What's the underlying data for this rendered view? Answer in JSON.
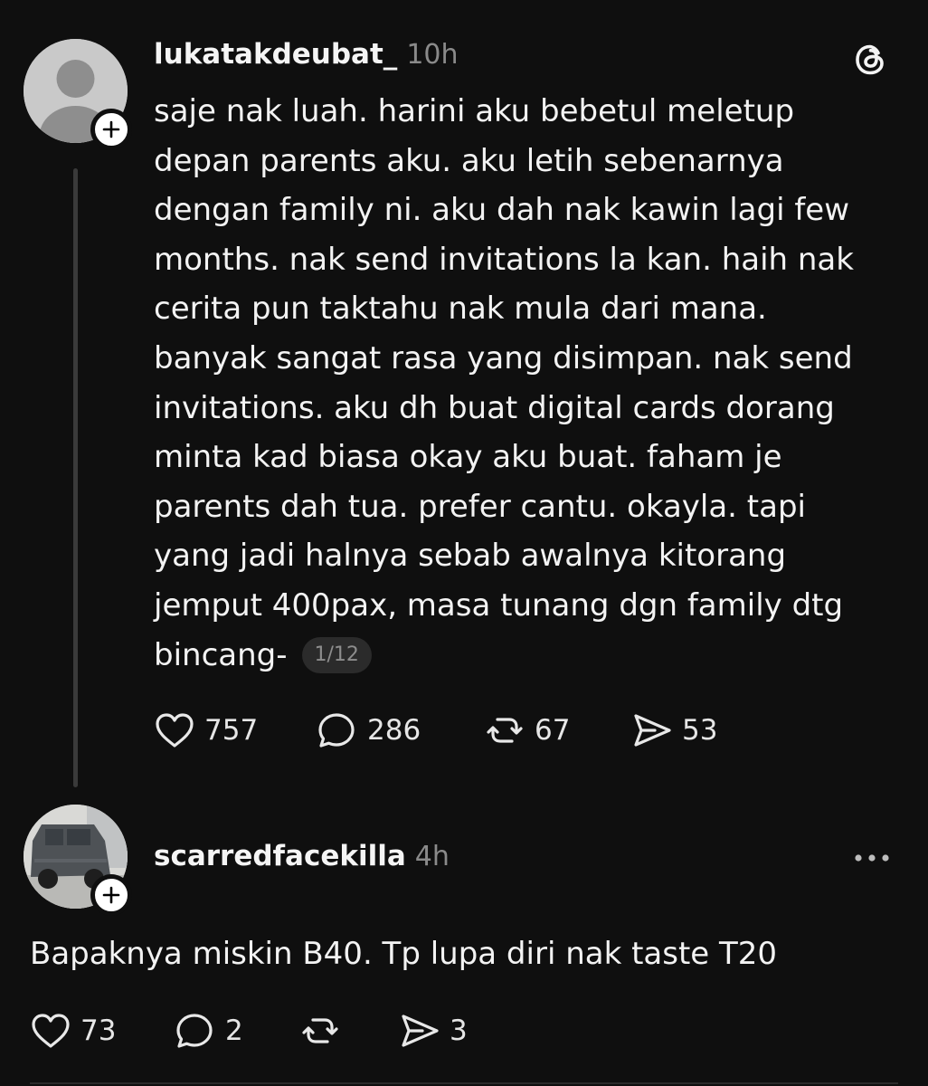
{
  "post": {
    "username": "lukatakdeubat_",
    "time": "10h",
    "lines": [
      "saje nak luah. harini aku bebetul meletup",
      "depan parents aku. aku letih sebenarnya",
      "dengan family ni. aku dah nak kawin lagi few",
      "months. nak send invitations la kan. haih nak",
      "cerita pun taktahu nak mula dari mana.",
      "banyak sangat rasa yang disimpan. nak send",
      "invitations. aku dh buat digital cards dorang",
      "minta kad biasa okay aku buat. faham je",
      "parents dah tua. prefer cantu. okayla. tapi",
      "yang jadi halnya sebab awalnya kitorang",
      "jemput 400pax, masa tunang dgn family dtg",
      "bincang-"
    ],
    "page_indicator": "1/12",
    "likes": "757",
    "replies": "286",
    "reposts": "67",
    "shares": "53"
  },
  "reply": {
    "username": "scarredfacekilla",
    "time": "4h",
    "text": "Bapaknya miskin B40. Tp lupa diri nak taste T20",
    "likes": "73",
    "replies": "2",
    "shares": "3"
  },
  "icons": {
    "follow": "plus-icon",
    "brand": "threads-logo-icon",
    "more": "more-icon",
    "like": "heart-icon",
    "reply": "comment-icon",
    "repost": "repost-icon",
    "share": "send-icon"
  },
  "colors": {
    "background": "#0f0f0f",
    "text": "#f3f3f3",
    "muted": "#8a8a8a"
  }
}
